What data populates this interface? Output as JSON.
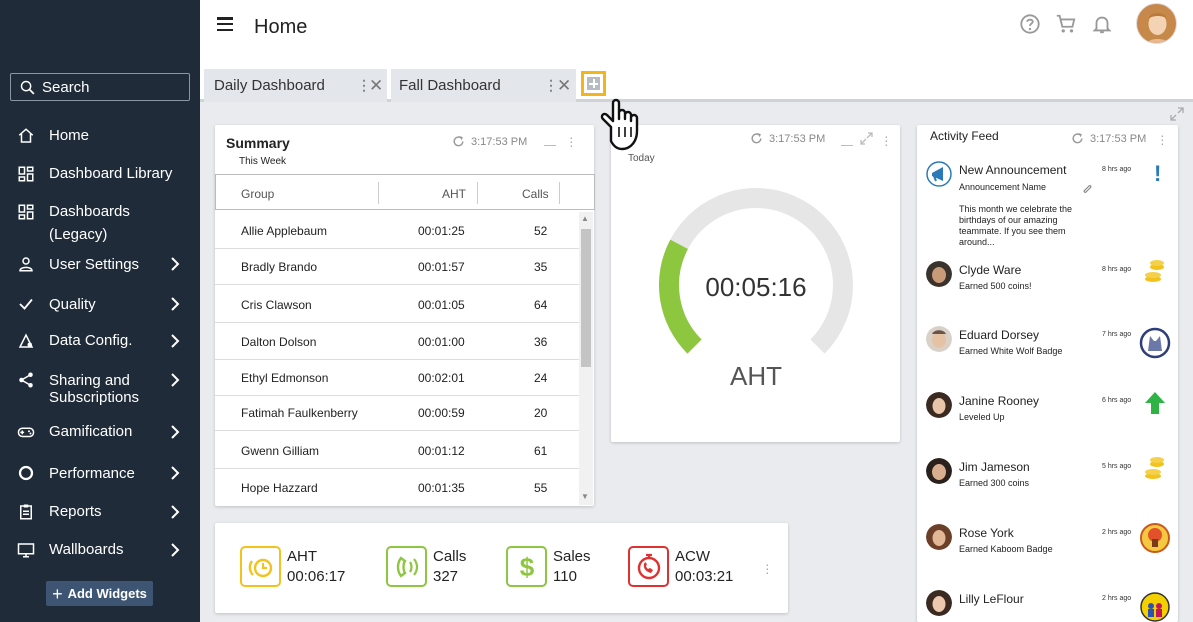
{
  "sidebar": {
    "search_placeholder": "Search",
    "items": [
      {
        "label": "Home"
      },
      {
        "label": "Dashboard Library"
      },
      {
        "label": "Dashboards",
        "label2": "(Legacy)"
      },
      {
        "label": "User Settings"
      },
      {
        "label": "Quality"
      },
      {
        "label": "Data Config."
      },
      {
        "label": "Sharing and",
        "label2": "Subscriptions"
      },
      {
        "label": "Gamification"
      },
      {
        "label": "Performance"
      },
      {
        "label": "Reports"
      },
      {
        "label": "Wallboards"
      }
    ],
    "add_widgets_label": "Add Widgets"
  },
  "header": {
    "title": "Home"
  },
  "tabs": [
    {
      "label": "Daily Dashboard",
      "active": false
    },
    {
      "label": "Fall Dashboard",
      "active": true
    }
  ],
  "summary": {
    "title": "Summary",
    "subtitle": "This Week",
    "timestamp": "3:17:53 PM",
    "columns": [
      "Group",
      "AHT",
      "Calls"
    ],
    "rows": [
      {
        "name": "Allie Applebaum",
        "aht": "00:01:25",
        "calls": "52"
      },
      {
        "name": "Bradly Brando",
        "aht": "00:01:57",
        "calls": "35"
      },
      {
        "name": "Cris Clawson",
        "aht": "00:01:05",
        "calls": "64"
      },
      {
        "name": "Dalton Dolson",
        "aht": "00:01:00",
        "calls": "36"
      },
      {
        "name": "Ethyl Edmonson",
        "aht": "00:02:01",
        "calls": "24"
      },
      {
        "name": "Fatimah Faulkenberry",
        "aht": "00:00:59",
        "calls": "20"
      },
      {
        "name": "Gwenn Gilliam",
        "aht": "00:01:12",
        "calls": "61"
      },
      {
        "name": "Hope Hazzard",
        "aht": "00:01:35",
        "calls": "55"
      }
    ]
  },
  "gauge": {
    "timestamp": "3:17:53 PM",
    "period": "Today",
    "value": "00:05:16",
    "label": "AHT",
    "fill_fraction": 0.27,
    "color_fill": "#8dc63f",
    "color_track": "#e6e6e6"
  },
  "kpis": [
    {
      "label": "AHT",
      "value": "00:06:17",
      "color": "#f2c31c",
      "icon": "clock-icon"
    },
    {
      "label": "Calls",
      "value": "327",
      "color": "#8dc63f",
      "icon": "phone-icon"
    },
    {
      "label": "Sales",
      "value": "110",
      "color": "#8dc63f",
      "icon": "dollar-icon"
    },
    {
      "label": "ACW",
      "value": "00:03:21",
      "color": "#e03131",
      "icon": "phone-timer-icon"
    }
  ],
  "feed": {
    "title": "Activity Feed",
    "timestamp": "3:17:53 PM",
    "announcement": {
      "name": "New Announcement",
      "desc": "Announcement Name",
      "time": "8 hrs ago",
      "body": "This month we celebrate the birthdays of our amazing teammate. If you see them around..."
    },
    "items": [
      {
        "name": "Clyde Ware",
        "desc": "Earned 500 coins!",
        "time": "8 hrs ago",
        "badge": "coins-icon"
      },
      {
        "name": "Eduard Dorsey",
        "desc": "Earned White Wolf Badge",
        "time": "7 hrs ago",
        "badge": "wolf-badge-icon"
      },
      {
        "name": "Janine Rooney",
        "desc": "Leveled Up",
        "time": "6 hrs ago",
        "badge": "level-up-arrow-icon"
      },
      {
        "name": "Jim Jameson",
        "desc": "Earned 300 coins",
        "time": "5 hrs ago",
        "badge": "coins-icon"
      },
      {
        "name": "Rose York",
        "desc": "Earned Kaboom Badge",
        "time": "2 hrs ago",
        "badge": "kaboom-badge-icon"
      },
      {
        "name": "Lilly LeFlour",
        "desc": "",
        "time": "2 hrs ago",
        "badge": "team-badge-icon"
      }
    ]
  },
  "colors": {
    "sidebar_bg": "#1f2b38",
    "accent_yellow": "#f2b51c",
    "add_widgets_bg": "#3d5573"
  }
}
